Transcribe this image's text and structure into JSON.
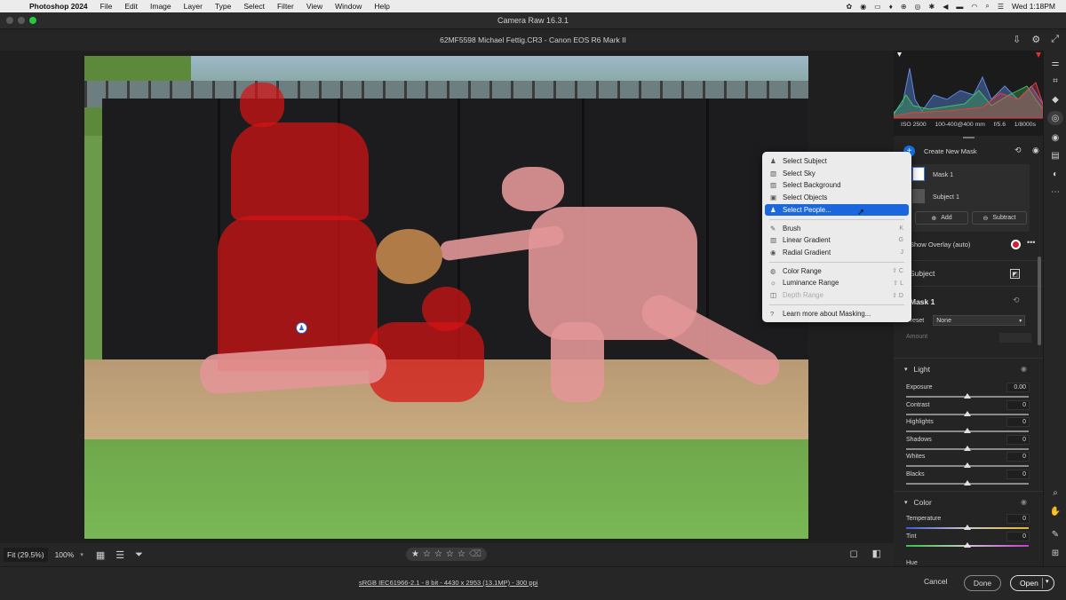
{
  "menubar": {
    "app_name": "Photoshop 2024",
    "items": [
      "File",
      "Edit",
      "Image",
      "Layer",
      "Type",
      "Select",
      "Filter",
      "View",
      "Window",
      "Help"
    ],
    "datetime": "Wed 1:18PM"
  },
  "window": {
    "title": "Camera Raw 16.3.1",
    "file_title": "62MF5598 Michael Fettig.CR3  -  Canon EOS R6 Mark II"
  },
  "histogram": {
    "iso": "ISO 2500",
    "lens": "100-400@400 mm",
    "aperture": "f/5.6",
    "shutter": "1/8000s"
  },
  "masks": {
    "create_label": "Create New Mask",
    "mask1_label": "Mask 1",
    "subject1_label": "Subject 1",
    "add_label": "Add",
    "subtract_label": "Subtract",
    "show_overlay_label": "Show Overlay (auto)",
    "subject_row_label": "Subject",
    "mask_title": "Mask 1",
    "preset_label": "Preset",
    "preset_value": "None",
    "amount_label": "Amount"
  },
  "light": {
    "title": "Light",
    "sliders": [
      {
        "label": "Exposure",
        "value": "0.00",
        "level": 0.5
      },
      {
        "label": "Contrast",
        "value": "0",
        "level": 0.5
      },
      {
        "label": "Highlights",
        "value": "0",
        "level": 0.5
      },
      {
        "label": "Shadows",
        "value": "0",
        "level": 0.5
      },
      {
        "label": "Whites",
        "value": "0",
        "level": 0.5
      },
      {
        "label": "Blacks",
        "value": "0",
        "level": 0.5
      }
    ]
  },
  "color": {
    "title": "Color",
    "sliders": [
      {
        "label": "Temperature",
        "value": "0",
        "level": 0.5
      },
      {
        "label": "Tint",
        "value": "0",
        "level": 0.5
      }
    ],
    "hue_label": "Hue"
  },
  "dropdown": {
    "items": [
      {
        "label": "Select Subject",
        "icon": "person-icon",
        "shortcut": "",
        "selected": false,
        "disabled": false
      },
      {
        "label": "Select Sky",
        "icon": "sky-icon",
        "shortcut": "",
        "selected": false,
        "disabled": false
      },
      {
        "label": "Select Background",
        "icon": "background-icon",
        "shortcut": "",
        "selected": false,
        "disabled": false
      },
      {
        "label": "Select Objects",
        "icon": "objects-icon",
        "shortcut": "",
        "selected": false,
        "disabled": false
      },
      {
        "label": "Select People...",
        "icon": "people-icon",
        "shortcut": "",
        "selected": true,
        "disabled": false
      },
      {
        "label": "Brush",
        "icon": "brush-icon",
        "shortcut": "K",
        "selected": false,
        "disabled": false
      },
      {
        "label": "Linear Gradient",
        "icon": "linear-gradient-icon",
        "shortcut": "G",
        "selected": false,
        "disabled": false
      },
      {
        "label": "Radial Gradient",
        "icon": "radial-gradient-icon",
        "shortcut": "J",
        "selected": false,
        "disabled": false
      },
      {
        "label": "Color Range",
        "icon": "color-range-icon",
        "shortcut": "⇧ C",
        "selected": false,
        "disabled": false
      },
      {
        "label": "Luminance Range",
        "icon": "luminance-range-icon",
        "shortcut": "⇧ L",
        "selected": false,
        "disabled": false
      },
      {
        "label": "Depth Range",
        "icon": "depth-range-icon",
        "shortcut": "⇧ D",
        "selected": false,
        "disabled": true
      },
      {
        "label": "Learn more about Masking...",
        "icon": "help-icon",
        "shortcut": "",
        "selected": false,
        "disabled": false
      }
    ]
  },
  "bottombar": {
    "fit_label": "Fit (29.5%)",
    "zoom_label": "100%",
    "rating": 0
  },
  "footer": {
    "file_info": "sRGB IEC61966-2.1 - 8 bit - 4430 x 2953 (13.1MP) - 300 ppi",
    "cancel_label": "Cancel",
    "done_label": "Done",
    "open_label": "Open"
  },
  "colors": {
    "accent": "#1473e6",
    "mask_overlay": "#d71414",
    "menu_selected": "#1a66dc"
  }
}
